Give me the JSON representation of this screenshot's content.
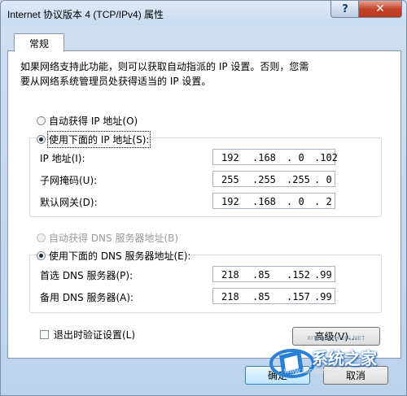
{
  "window": {
    "title": "Internet 协议版本 4 (TCP/IPv4) 属性",
    "help_glyph": "?",
    "close_glyph": "✕"
  },
  "tab": {
    "label": "常规"
  },
  "description": {
    "line1": "如果网络支持此功能，则可以获取自动指派的 IP 设置。否则，您需",
    "line2": "要从网络系统管理员处获得适当的 IP 设置。"
  },
  "ip_mode": {
    "auto_label": "自动获得 IP 地址(O)",
    "manual_label": "使用下面的 IP 地址(S):",
    "selected": "manual"
  },
  "ip_fields": [
    {
      "label": "IP 地址(I):",
      "octets": [
        "192",
        ".168",
        ".  0",
        ".102"
      ]
    },
    {
      "label": "子网掩码(U):",
      "octets": [
        "255",
        ".255",
        ".255",
        ".  0"
      ]
    },
    {
      "label": "默认网关(D):",
      "octets": [
        "192",
        ".168",
        ".  0",
        ".  2"
      ]
    }
  ],
  "dns_mode": {
    "auto_label": "自动获得 DNS 服务器地址(B)",
    "manual_label": "使用下面的 DNS 服务器地址(E):",
    "selected": "manual"
  },
  "dns_fields": [
    {
      "label": "首选 DNS 服务器(P):",
      "octets": [
        "218",
        ".85",
        ".152",
        ".99"
      ]
    },
    {
      "label": "备用 DNS 服务器(A):",
      "octets": [
        "218",
        ".85",
        ".157",
        ".99"
      ]
    }
  ],
  "validate_on_exit": {
    "label": "退出时验证设置(L)",
    "checked": false
  },
  "buttons": {
    "advanced": "高级(V)...",
    "ok": "确定",
    "cancel": "取消"
  },
  "watermark": {
    "small": "XITONGZHIJIA.NET",
    "big": "系统之家",
    "url": "www.xitongzhijia.net"
  }
}
